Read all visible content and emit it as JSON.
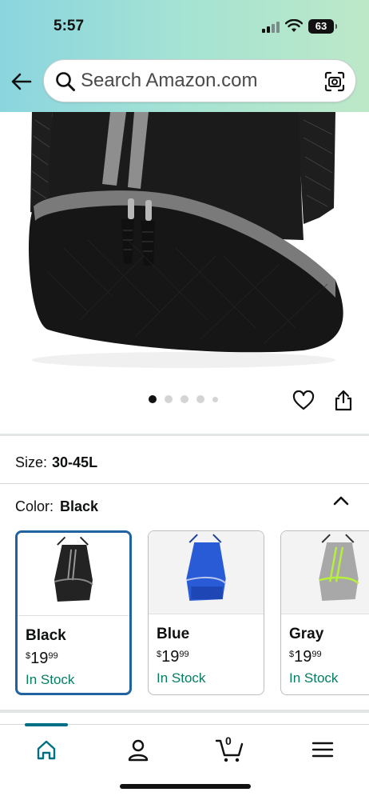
{
  "status_bar": {
    "time": "5:57",
    "battery": "63"
  },
  "header": {
    "back_icon": "arrow-left-icon",
    "search": {
      "placeholder": "Search Amazon.com",
      "icon": "search-icon",
      "camera_icon": "camera-scan-icon"
    },
    "gradient_colors": [
      "#8bd5df",
      "#a5e3d3",
      "#bde8c8"
    ]
  },
  "product_image": {
    "total_images": 5,
    "active_index": 0
  },
  "actions": {
    "heart_icon": "heart-icon",
    "share_icon": "share-icon"
  },
  "size": {
    "label": "Size:",
    "value": "30-45L"
  },
  "color": {
    "label": "Color:",
    "value": "Black",
    "chevron_icon": "chevron-up-icon"
  },
  "swatches": [
    {
      "name": "Black",
      "currency": "$",
      "dollars": "19",
      "cents": "99",
      "stock": "In Stock",
      "selected": true
    },
    {
      "name": "Blue",
      "currency": "$",
      "dollars": "19",
      "cents": "99",
      "stock": "In Stock",
      "selected": false
    },
    {
      "name": "Gray",
      "currency": "$",
      "dollars": "19",
      "cents": "99",
      "stock": "In Stock",
      "selected": false
    }
  ],
  "bottom_nav": {
    "items": [
      "home-icon",
      "account-icon",
      "cart-icon",
      "menu-icon"
    ],
    "cart_count": "0",
    "active": "home-icon"
  },
  "colors": {
    "selected_border": "#2162a1",
    "in_stock": "#067d62",
    "nav_active": "#007185"
  }
}
